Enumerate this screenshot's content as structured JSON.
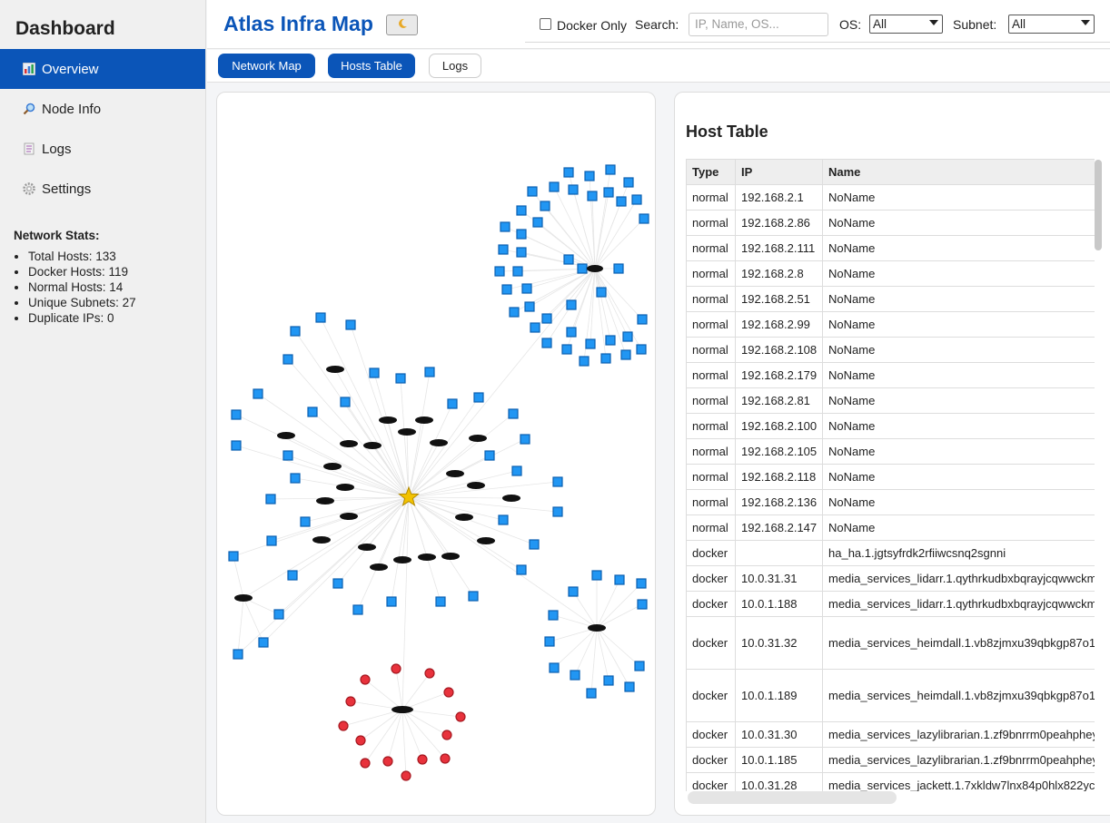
{
  "sidebar": {
    "title": "Dashboard",
    "items": [
      {
        "label": "Overview",
        "icon": "chart-icon"
      },
      {
        "label": "Node Info",
        "icon": "magnifier-icon"
      },
      {
        "label": "Logs",
        "icon": "document-icon"
      },
      {
        "label": "Settings",
        "icon": "gear-icon"
      }
    ],
    "stats_title": "Network Stats:",
    "stats": [
      "Total Hosts: 133",
      "Docker Hosts: 119",
      "Normal Hosts: 14",
      "Unique Subnets: 27",
      "Duplicate IPs: 0"
    ]
  },
  "header": {
    "title": "Atlas Infra Map",
    "theme_icon": "moon-icon",
    "docker_only_label": "Docker Only",
    "search_label": "Search:",
    "search_placeholder": "IP, Name, OS...",
    "os_label": "OS:",
    "os_value": "All",
    "subnet_label": "Subnet:",
    "subnet_value": "All"
  },
  "tabs": [
    {
      "label": "Network Map"
    },
    {
      "label": "Hosts Table"
    },
    {
      "label": "Logs"
    }
  ],
  "colors": {
    "accent": "#0b55b8",
    "docker_node": "#2196f3",
    "normal_node": "#e8323c",
    "hub": "#111111",
    "root_star": "#f2c200"
  },
  "table": {
    "title": "Host Table",
    "columns": [
      "Type",
      "IP",
      "Name"
    ],
    "rows": [
      [
        "normal",
        "192.168.2.1",
        "NoName"
      ],
      [
        "normal",
        "192.168.2.86",
        "NoName"
      ],
      [
        "normal",
        "192.168.2.111",
        "NoName"
      ],
      [
        "normal",
        "192.168.2.8",
        "NoName"
      ],
      [
        "normal",
        "192.168.2.51",
        "NoName"
      ],
      [
        "normal",
        "192.168.2.99",
        "NoName"
      ],
      [
        "normal",
        "192.168.2.108",
        "NoName"
      ],
      [
        "normal",
        "192.168.2.179",
        "NoName"
      ],
      [
        "normal",
        "192.168.2.81",
        "NoName"
      ],
      [
        "normal",
        "192.168.2.100",
        "NoName"
      ],
      [
        "normal",
        "192.168.2.105",
        "NoName"
      ],
      [
        "normal",
        "192.168.2.118",
        "NoName"
      ],
      [
        "normal",
        "192.168.2.136",
        "NoName"
      ],
      [
        "normal",
        "192.168.2.147",
        "NoName"
      ],
      [
        "docker",
        "",
        "ha_ha.1.jgtsyfrdk2rfiiwcsnq2sgnni"
      ],
      [
        "docker",
        "10.0.31.31",
        "media_services_lidarr.1.qythrkudbxbqrayjcqwwckm"
      ],
      [
        "docker",
        "10.0.1.188",
        "media_services_lidarr.1.qythrkudbxbqrayjcqwwckm"
      ],
      [
        "docker",
        "10.0.31.32",
        "media_services_heimdall.1.vb8zjmxu39qbkgp87o1"
      ],
      [
        "docker",
        "10.0.1.189",
        "media_services_heimdall.1.vb8zjmxu39qbkgp87o1"
      ],
      [
        "docker",
        "10.0.31.30",
        "media_services_lazylibrarian.1.zf9bnrrm0peahphey"
      ],
      [
        "docker",
        "10.0.1.185",
        "media_services_lazylibrarian.1.zf9bnrrm0peahphey"
      ],
      [
        "docker",
        "10.0.31.28",
        "media_services_jackett.1.7xkldw7lnx84p0hlx822yc"
      ]
    ]
  }
}
